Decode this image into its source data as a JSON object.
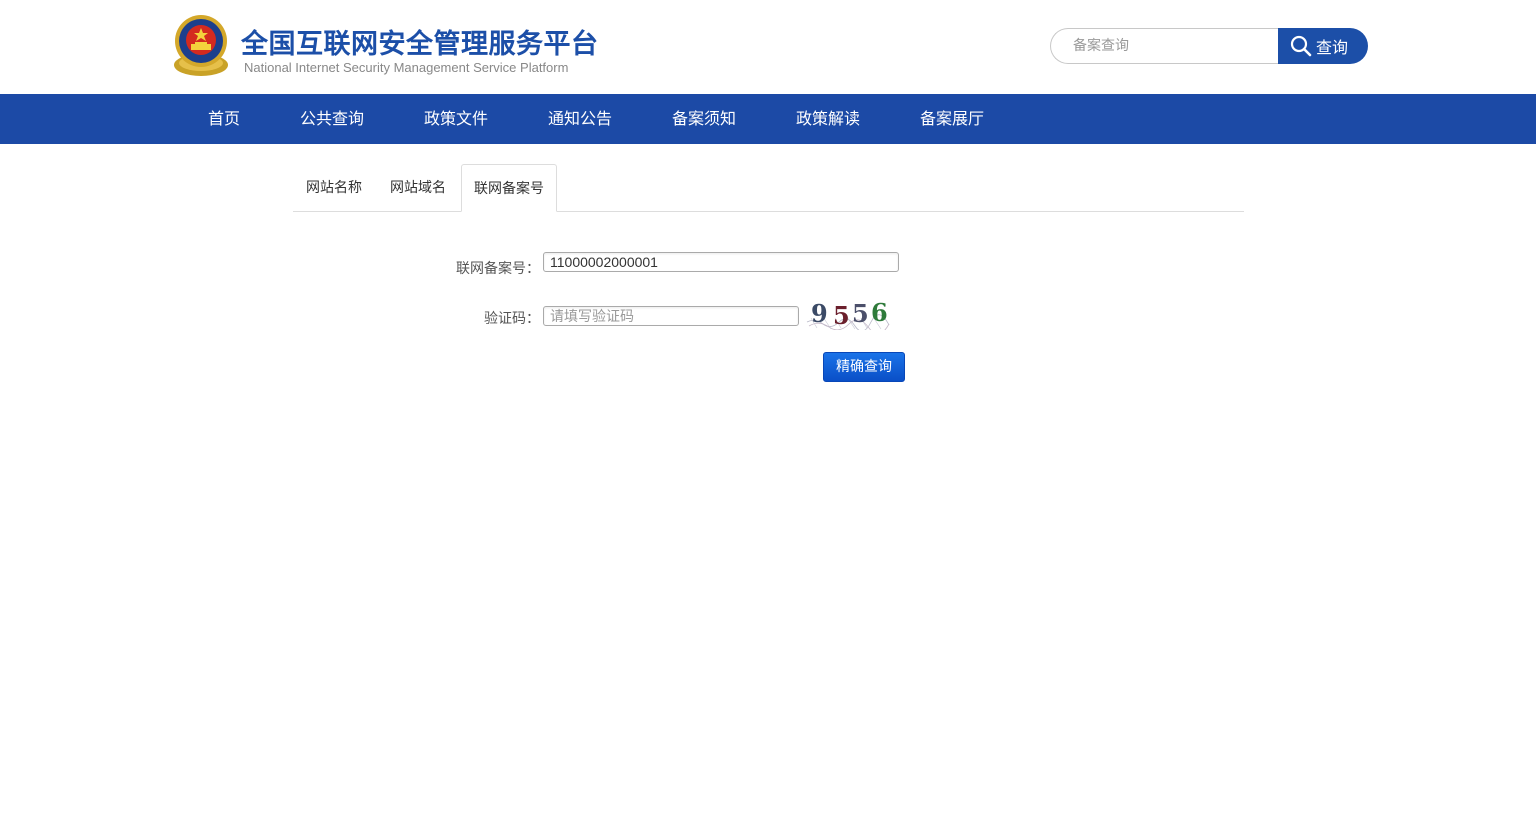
{
  "header": {
    "title": "全国互联网安全管理服务平台",
    "subtitle": "National Internet Security Management Service Platform",
    "search_placeholder": "备案查询",
    "search_button": "查询"
  },
  "nav": {
    "items": [
      "首页",
      "公共查询",
      "政策文件",
      "通知公告",
      "备案须知",
      "政策解读",
      "备案展厅"
    ]
  },
  "tabs": {
    "items": [
      "网站名称",
      "网站域名",
      "联网备案号"
    ],
    "active": "联网备案号"
  },
  "form": {
    "record_label": "联网备案号：",
    "record_value": "11000002000001",
    "captcha_label": "验证码：",
    "captcha_placeholder": "请填写验证码",
    "captcha_text": "9556",
    "submit_label": "精确查询"
  },
  "colors": {
    "brand_blue": "#1c4fa8",
    "nav_blue": "#1c4aa6",
    "button_blue": "#0a5fd8"
  }
}
